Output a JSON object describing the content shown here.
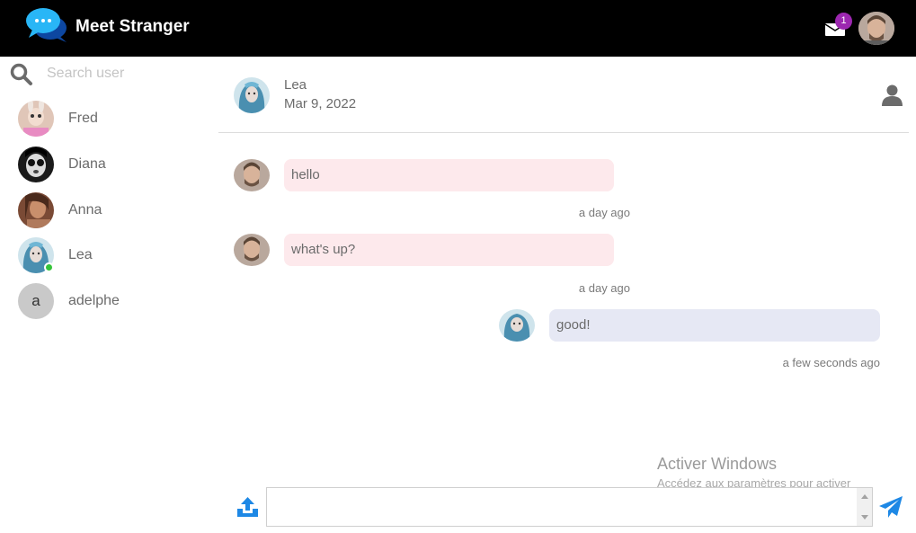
{
  "header": {
    "app_title": "Meet Stranger",
    "mail_badge": "1",
    "brand_color": "#1e88e5"
  },
  "sidebar": {
    "search_placeholder": "Search user",
    "users": [
      {
        "name": "Fred",
        "online": false
      },
      {
        "name": "Diana",
        "online": false
      },
      {
        "name": "Anna",
        "online": false
      },
      {
        "name": "Lea",
        "online": true
      },
      {
        "name": "adelphe",
        "online": false,
        "initial": "a"
      }
    ]
  },
  "chat": {
    "contact_name": "Lea",
    "contact_date": "Mar 9, 2022",
    "messages": [
      {
        "text": "hello",
        "time": "a day ago",
        "direction": "incoming"
      },
      {
        "text": "what's up?",
        "time": "a day ago",
        "direction": "incoming"
      },
      {
        "text": "good!",
        "time": "a few seconds ago",
        "direction": "outgoing"
      }
    ]
  },
  "composer": {
    "value": ""
  },
  "watermark": {
    "title": "Activer Windows",
    "subtitle": "Accédez aux paramètres pour activer Windows."
  }
}
